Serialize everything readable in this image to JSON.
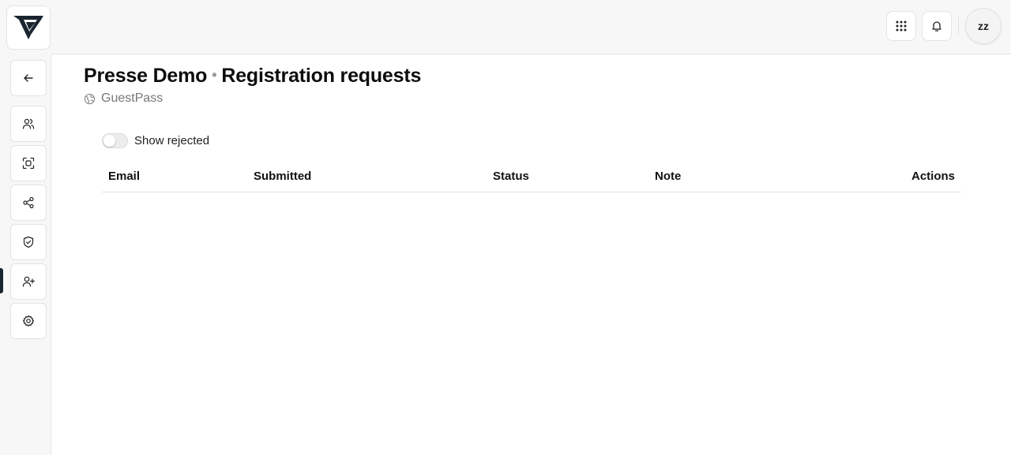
{
  "header": {
    "avatar_initials": "zz",
    "apps_icon": "grid-dots-icon",
    "notifications_icon": "bell-icon"
  },
  "sidebar": {
    "items": [
      {
        "name": "back",
        "icon": "arrow-left-icon"
      },
      {
        "name": "users",
        "icon": "users-icon"
      },
      {
        "name": "scan",
        "icon": "face-scan-icon"
      },
      {
        "name": "share",
        "icon": "share-icon"
      },
      {
        "name": "security",
        "icon": "shield-check-icon"
      },
      {
        "name": "registrations",
        "icon": "user-plus-icon",
        "active": true
      },
      {
        "name": "settings",
        "icon": "gear-icon"
      }
    ]
  },
  "page": {
    "title_primary": "Presse Demo",
    "title_separator": "•",
    "title_secondary": "Registration requests",
    "subtitle": "GuestPass"
  },
  "filters": {
    "show_rejected_label": "Show rejected",
    "show_rejected_checked": false
  },
  "table": {
    "columns": [
      "Email",
      "Submitted",
      "Status",
      "Note",
      "Actions"
    ],
    "rows": []
  },
  "colors": {
    "active_marker": "#1a2530",
    "logo": "#1a2530"
  }
}
